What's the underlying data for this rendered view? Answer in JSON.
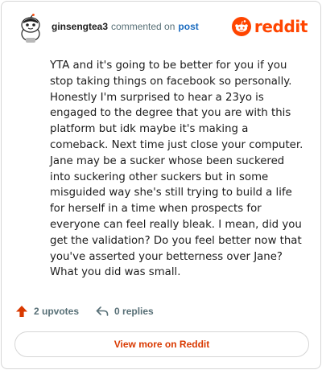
{
  "comment": {
    "username": "ginsengtea3",
    "action_text": "commented on",
    "post_link_label": "post",
    "body": "YTA and it's going to be better for you if you stop taking things on facebook so personally. Honestly I'm surprised to hear a 23yo is engaged to the degree that you are with this platform but idk maybe it's making a comeback. Next time just close your computer. Jane may be a sucker whose been suckered into suckering other suckers but in some misguided way she's still trying to build a life for herself in a time when prospects for everyone can feel really bleak. I mean, did you get the validation? Do you feel better now that you've asserted your betterness over Jane? What you did was small."
  },
  "brand": {
    "wordmark": "reddit",
    "color": "#ff4500"
  },
  "actions": {
    "upvotes_label": "2 upvotes",
    "replies_label": "0 replies"
  },
  "footer": {
    "view_more_label": "View more on Reddit"
  },
  "icons": {
    "avatar": "avatar-icon",
    "brand": "reddit-logo-icon",
    "upvote": "upvote-arrow-icon",
    "reply": "reply-arrow-icon"
  }
}
